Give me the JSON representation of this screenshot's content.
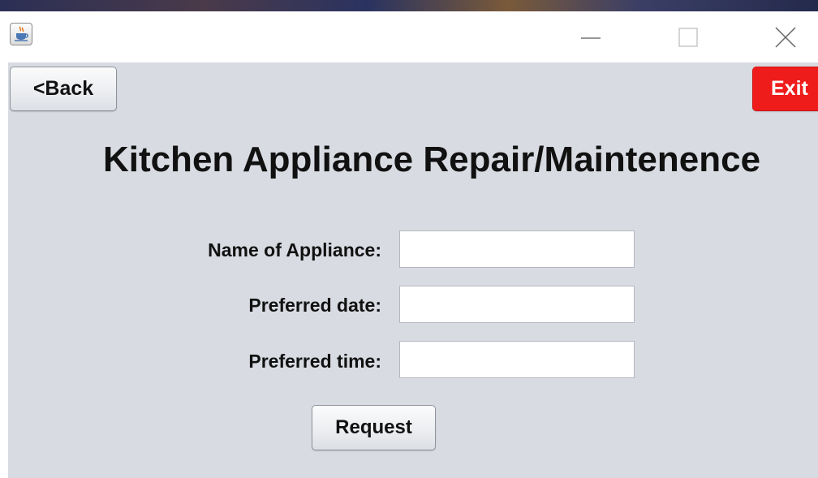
{
  "window": {
    "controls": [
      "minimize",
      "maximize",
      "close"
    ]
  },
  "toolbar": {
    "back_label": "<Back",
    "exit_label": "Exit",
    "exit_color": "#ef1c1c"
  },
  "page": {
    "title": "Kitchen Appliance Repair/Maintenence"
  },
  "form": {
    "fields": [
      {
        "label": "Name of Appliance:",
        "value": "",
        "placeholder": ""
      },
      {
        "label": "Preferred date:",
        "value": "",
        "placeholder": ""
      },
      {
        "label": "Preferred time:",
        "value": "",
        "placeholder": ""
      }
    ],
    "submit_label": "Request"
  },
  "colors": {
    "content_bg": "#d8dbe2",
    "title_bar_bg": "#ffffff"
  },
  "icons": {
    "app": "java-cup-icon",
    "minimize": "minimize-icon",
    "maximize": "maximize-icon",
    "close": "close-icon"
  }
}
